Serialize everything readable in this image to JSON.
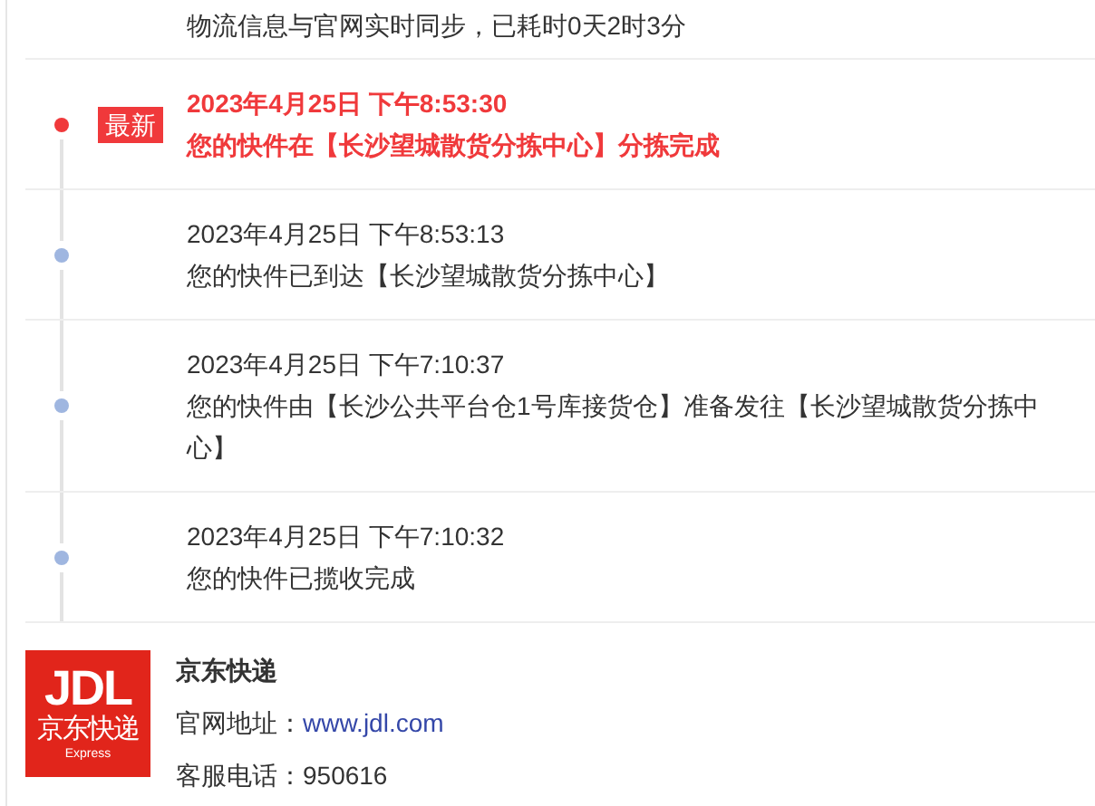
{
  "sync_note": "物流信息与官网实时同步，已耗时0天2时3分",
  "events": [
    {
      "date": "2023年4月25日 下午8:53:30",
      "description": "您的快件在【长沙望城散货分拣中心】分拣完成",
      "latest": true,
      "badge": "最新"
    },
    {
      "date": "2023年4月25日 下午8:53:13",
      "description": "您的快件已到达【长沙望城散货分拣中心】",
      "latest": false
    },
    {
      "date": "2023年4月25日 下午7:10:37",
      "description": "您的快件由【长沙公共平台仓1号库接货仓】准备发往【长沙望城散货分拣中心】",
      "latest": false
    },
    {
      "date": "2023年4月25日 下午7:10:32",
      "description": "您的快件已揽收完成",
      "latest": false
    }
  ],
  "carrier": {
    "logo": {
      "wordmark": "JDL",
      "name": "京东快递",
      "tagline": "Express"
    },
    "name": "京东快递",
    "website_label": "官网地址：",
    "website": "www.jdl.com",
    "phone_label": "客服电话：",
    "phone": "950616"
  }
}
